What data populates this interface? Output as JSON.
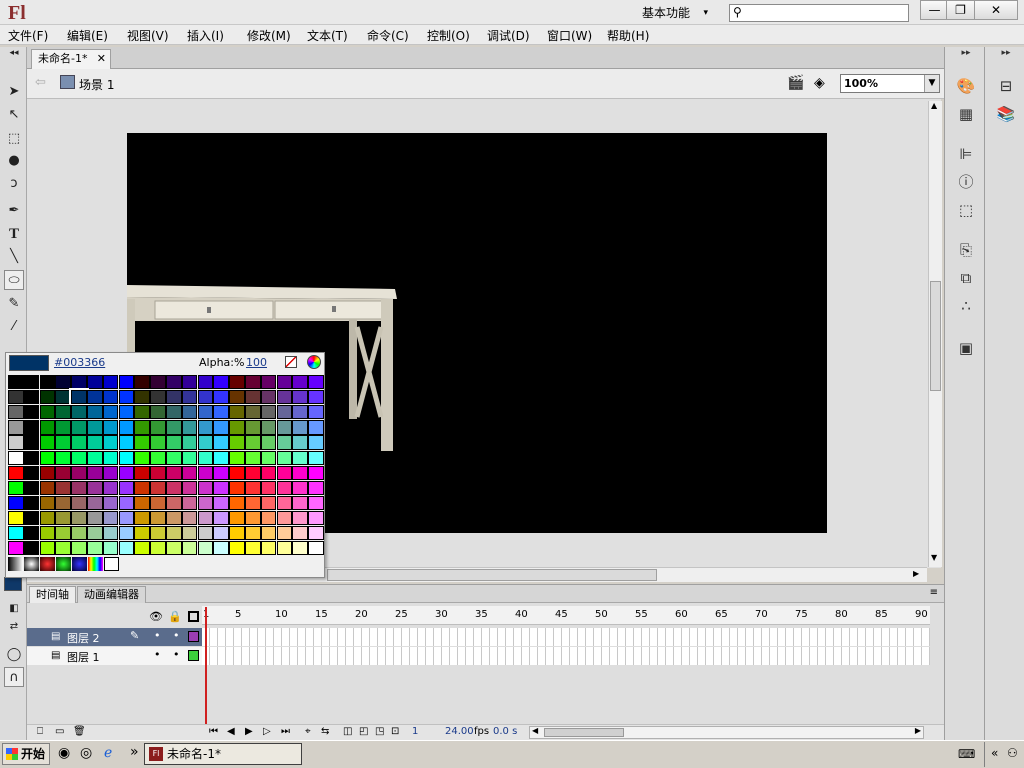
{
  "app": {
    "logo": "Fl",
    "workspace": "基本功能",
    "search_placeholder": "",
    "window_buttons": [
      "—",
      "❐",
      "✕"
    ]
  },
  "menu": [
    "文件(F)",
    "编辑(E)",
    "视图(V)",
    "插入(I)",
    "修改(M)",
    "文本(T)",
    "命令(C)",
    "控制(O)",
    "调试(D)",
    "窗口(W)",
    "帮助(H)"
  ],
  "document": {
    "tab_title": "未命名-1*",
    "scene": "场景 1",
    "zoom": "100%"
  },
  "palette": {
    "current_hex": "#003366",
    "current_color": "#003366",
    "alpha_label": "Alpha:%",
    "alpha_value": "100"
  },
  "timeline": {
    "tabs": [
      "时间轴",
      "动画编辑器"
    ],
    "ruler_ticks": [
      "1",
      "5",
      "10",
      "15",
      "20",
      "25",
      "30",
      "35",
      "40",
      "45",
      "50",
      "55",
      "60",
      "65",
      "70",
      "75",
      "80",
      "85",
      "90"
    ],
    "layers": [
      {
        "name": "图层 2",
        "color": "#9b3db3",
        "selected": true
      },
      {
        "name": "图层 1",
        "color": "#3ccf3c",
        "selected": false
      }
    ],
    "current_frame": "1",
    "fps": "24.00",
    "fps_unit": "fps",
    "time": "0.0 s"
  },
  "taskbar": {
    "start": "开始",
    "task_title": "未命名-1*",
    "chevron": "»"
  }
}
